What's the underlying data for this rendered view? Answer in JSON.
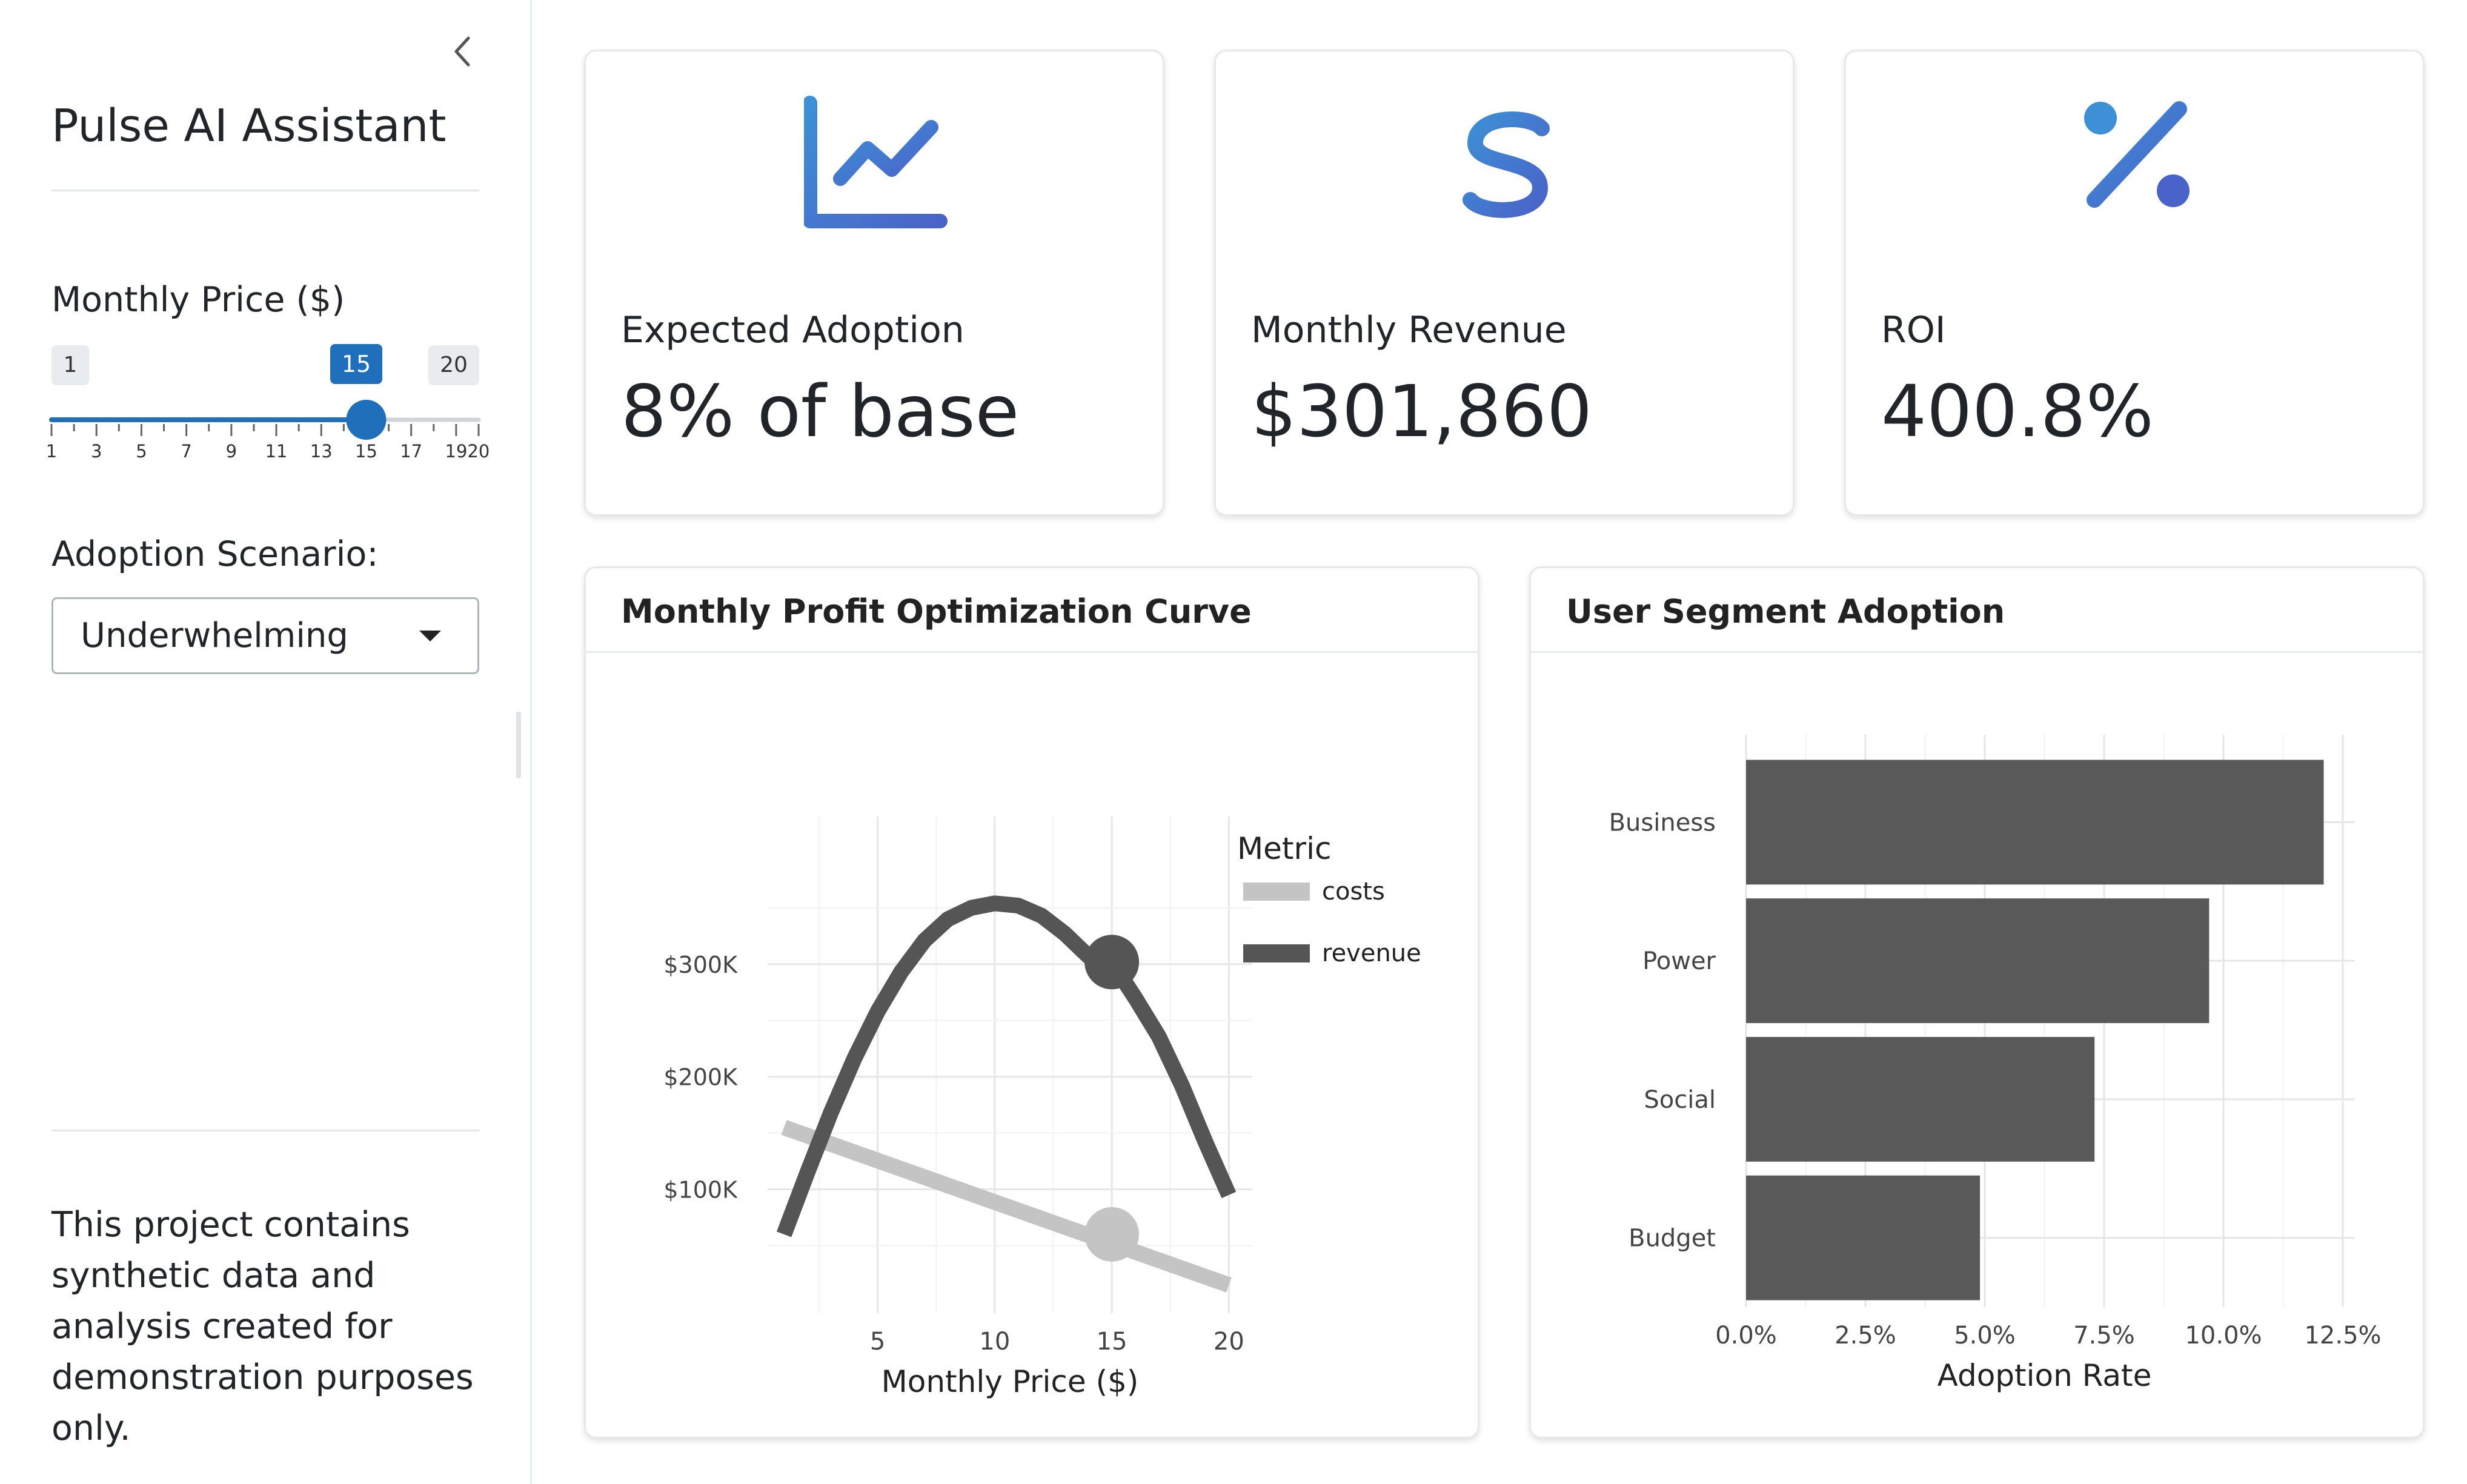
{
  "sidebar": {
    "title": "Pulse AI Assistant",
    "collapse_icon": "chevron-left-icon",
    "price_slider": {
      "label": "Monthly Price ($)",
      "min": 1,
      "max": 20,
      "value": 15,
      "ticks": [
        "1",
        "3",
        "5",
        "7",
        "9",
        "11",
        "13",
        "15",
        "17",
        "1920"
      ]
    },
    "scenario": {
      "label": "Adoption Scenario:",
      "selected": "Underwhelming"
    },
    "disclaimer": "This project contains synthetic data and analysis created for demonstration purposes only."
  },
  "kpis": [
    {
      "icon": "chart-line-icon",
      "label": "Expected Adoption",
      "value": "8% of base"
    },
    {
      "icon": "dollar-sign-icon",
      "label": "Monthly Revenue",
      "value": "$301,860"
    },
    {
      "icon": "percent-icon",
      "label": "ROI",
      "value": "400.8%"
    }
  ],
  "colors": {
    "accent": "#1f6fba",
    "icon_gradient_start": "#3d8fd6",
    "icon_gradient_end": "#4a63c8",
    "revenue": "#555555",
    "costs": "#c4c4c4",
    "bar": "#595959"
  },
  "charts": {
    "profit": {
      "title": "Monthly Profit Optimization Curve"
    },
    "segment": {
      "title": "User Segment Adoption"
    }
  },
  "chart_data": [
    {
      "type": "line",
      "title": "Monthly Profit Optimization Curve",
      "xlabel": "Monthly Price ($)",
      "ylabel": "",
      "xlim": [
        0.3,
        21
      ],
      "ylim": [
        -10000,
        415000
      ],
      "x_ticks": [
        "5",
        "10",
        "15",
        "20"
      ],
      "y_ticks": [
        "$100K",
        "$200K",
        "$300K"
      ],
      "legend": {
        "title": "Metric",
        "position": "right",
        "entries": [
          "costs",
          "revenue"
        ]
      },
      "grid": true,
      "series": [
        {
          "name": "revenue",
          "x": [
            1,
            2,
            3,
            4,
            5,
            6,
            7,
            8,
            9,
            10,
            11,
            12,
            13,
            14,
            15,
            16,
            17,
            18,
            19,
            20
          ],
          "y": [
            60000,
            115000,
            168000,
            216000,
            258000,
            293000,
            321000,
            340000,
            350000,
            354000,
            352000,
            343000,
            327000,
            307000,
            301860,
            270000,
            236000,
            192000,
            142000,
            95000
          ]
        },
        {
          "name": "costs",
          "x": [
            1,
            20
          ],
          "y": [
            155000,
            15000
          ]
        }
      ],
      "highlight_x": 15,
      "highlight_points": [
        {
          "series": "revenue",
          "x": 15,
          "y": 301860
        },
        {
          "series": "costs",
          "x": 15,
          "y": 60000
        }
      ]
    },
    {
      "type": "bar",
      "orientation": "horizontal",
      "title": "User Segment Adoption",
      "xlabel": "Adoption Rate",
      "ylabel": "",
      "categories": [
        "Business",
        "Power",
        "Social",
        "Budget"
      ],
      "values": [
        12.1,
        9.7,
        7.3,
        4.9
      ],
      "xlim": [
        0,
        12.5
      ],
      "x_ticks": [
        "0.0%",
        "2.5%",
        "5.0%",
        "7.5%",
        "10.0%",
        "12.5%"
      ],
      "grid": true
    }
  ]
}
